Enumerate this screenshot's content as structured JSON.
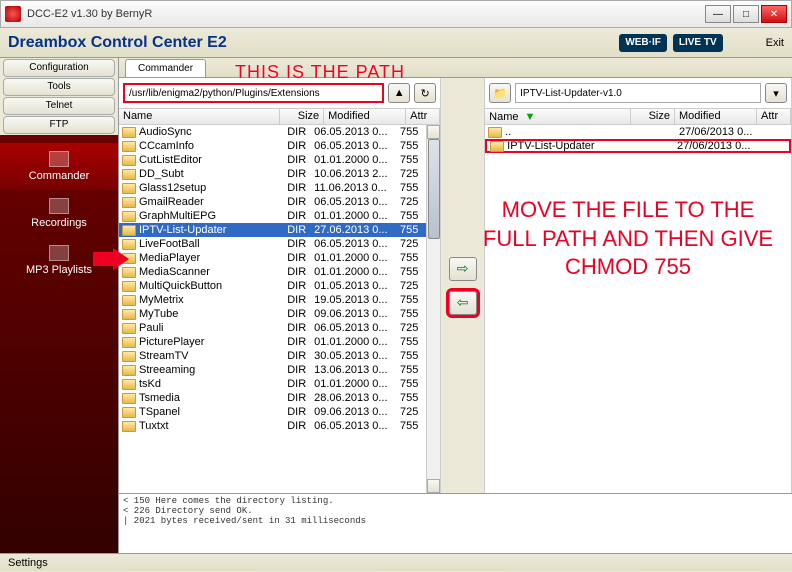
{
  "window": {
    "title": "DCC-E2 v1.30 by BernyR"
  },
  "app": {
    "name": "Dreambox Control Center E2",
    "logo1": "WEB·IF",
    "logo2": "LIVE TV",
    "exit": "Exit"
  },
  "sidebar": {
    "top": [
      "Configuration",
      "Tools",
      "Telnet",
      "FTP"
    ],
    "items": [
      {
        "label": "Commander",
        "active": true
      },
      {
        "label": "Recordings",
        "active": false
      },
      {
        "label": "MP3 Playlists",
        "active": false
      }
    ],
    "settings": "Settings"
  },
  "tabs": [
    "Commander"
  ],
  "annot": {
    "path": "this is the path",
    "move": "Move the file to the full path and then give CHMOD 755"
  },
  "left": {
    "path": "/usr/lib/enigma2/python/Plugins/Extensions",
    "cols": {
      "name": "Name",
      "size": "Size",
      "modified": "Modified",
      "attr": "Attr"
    },
    "rows": [
      {
        "name": "AudioSync",
        "size": "DIR",
        "mod": "06.05.2013 0...",
        "attr": "755"
      },
      {
        "name": "CCcamInfo",
        "size": "DIR",
        "mod": "06.05.2013 0...",
        "attr": "755"
      },
      {
        "name": "CutListEditor",
        "size": "DIR",
        "mod": "01.01.2000 0...",
        "attr": "755"
      },
      {
        "name": "DD_Subt",
        "size": "DIR",
        "mod": "10.06.2013 2...",
        "attr": "725"
      },
      {
        "name": "Glass12setup",
        "size": "DIR",
        "mod": "11.06.2013 0...",
        "attr": "755"
      },
      {
        "name": "GmailReader",
        "size": "DIR",
        "mod": "06.05.2013 0...",
        "attr": "725"
      },
      {
        "name": "GraphMultiEPG",
        "size": "DIR",
        "mod": "01.01.2000 0...",
        "attr": "755"
      },
      {
        "name": "IPTV-List-Updater",
        "size": "DIR",
        "mod": "27.06.2013 0...",
        "attr": "755",
        "sel": true
      },
      {
        "name": "LiveFootBall",
        "size": "DIR",
        "mod": "06.05.2013 0...",
        "attr": "725"
      },
      {
        "name": "MediaPlayer",
        "size": "DIR",
        "mod": "01.01.2000 0...",
        "attr": "755"
      },
      {
        "name": "MediaScanner",
        "size": "DIR",
        "mod": "01.01.2000 0...",
        "attr": "755"
      },
      {
        "name": "MultiQuickButton",
        "size": "DIR",
        "mod": "01.05.2013 0...",
        "attr": "725"
      },
      {
        "name": "MyMetrix",
        "size": "DIR",
        "mod": "19.05.2013 0...",
        "attr": "755"
      },
      {
        "name": "MyTube",
        "size": "DIR",
        "mod": "09.06.2013 0...",
        "attr": "755"
      },
      {
        "name": "Pauli",
        "size": "DIR",
        "mod": "06.05.2013 0...",
        "attr": "725"
      },
      {
        "name": "PicturePlayer",
        "size": "DIR",
        "mod": "01.01.2000 0...",
        "attr": "755"
      },
      {
        "name": "StreamTV",
        "size": "DIR",
        "mod": "30.05.2013 0...",
        "attr": "755"
      },
      {
        "name": "Streeaming",
        "size": "DIR",
        "mod": "13.06.2013 0...",
        "attr": "755"
      },
      {
        "name": "tsKd",
        "size": "DIR",
        "mod": "01.01.2000 0...",
        "attr": "755"
      },
      {
        "name": "Tsmedia",
        "size": "DIR",
        "mod": "28.06.2013 0...",
        "attr": "755"
      },
      {
        "name": "TSpanel",
        "size": "DIR",
        "mod": "09.06.2013 0...",
        "attr": "725"
      },
      {
        "name": "Tuxtxt",
        "size": "DIR",
        "mod": "06.05.2013 0...",
        "attr": "755"
      }
    ]
  },
  "right": {
    "path": "IPTV-List-Updater-v1.0",
    "cols": {
      "name": "Name",
      "size": "Size",
      "modified": "Modified",
      "attr": "Attr"
    },
    "rows": [
      {
        "name": "..",
        "size": "",
        "mod": "27/06/2013 0...",
        "attr": ""
      },
      {
        "name": "IPTV-List-Updater",
        "size": "",
        "mod": "27/06/2013 0...",
        "attr": "",
        "boxed": true
      }
    ]
  },
  "log": "< 150 Here comes the directory listing.\n< 226 Directory send OK.\n| 2021 bytes received/sent in 31 milliseconds"
}
